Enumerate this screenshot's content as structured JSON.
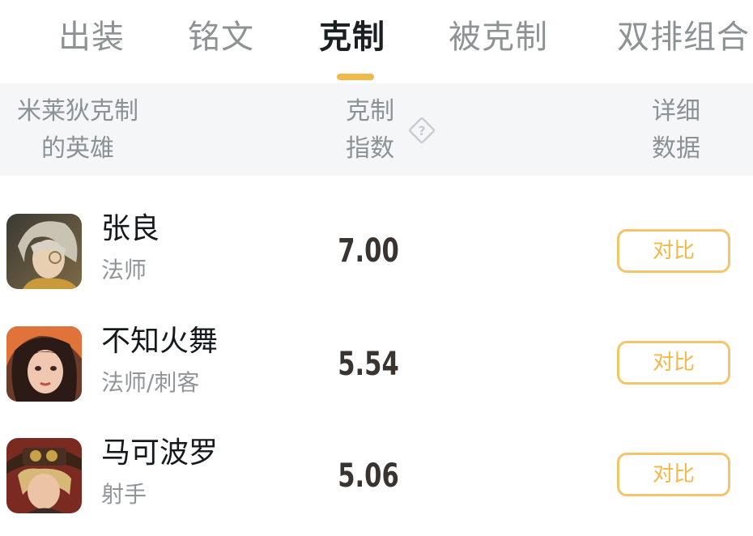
{
  "tabs": [
    {
      "label": "出装"
    },
    {
      "label": "铭文"
    },
    {
      "label": "克制",
      "active": true
    },
    {
      "label": "被克制"
    },
    {
      "label": "双排组合"
    }
  ],
  "header": {
    "col1_line1": "米莱狄克制",
    "col1_line2": "的英雄",
    "col2_line1": "克制",
    "col2_line2": "指数",
    "col3_line1": "详细",
    "col3_line2": "数据",
    "help_icon": "question-diamond-icon"
  },
  "heroes": [
    {
      "name": "张良",
      "role": "法师",
      "score": "7.00",
      "button": "对比"
    },
    {
      "name": "不知火舞",
      "role": "法师/刺客",
      "score": "5.54",
      "button": "对比"
    },
    {
      "name": "马可波罗",
      "role": "射手",
      "score": "5.06",
      "button": "对比"
    }
  ],
  "colors": {
    "accent": "#f1b94a",
    "header_bg": "#f4f6f7",
    "text_primary": "#15191b",
    "text_secondary": "#8d9293"
  }
}
